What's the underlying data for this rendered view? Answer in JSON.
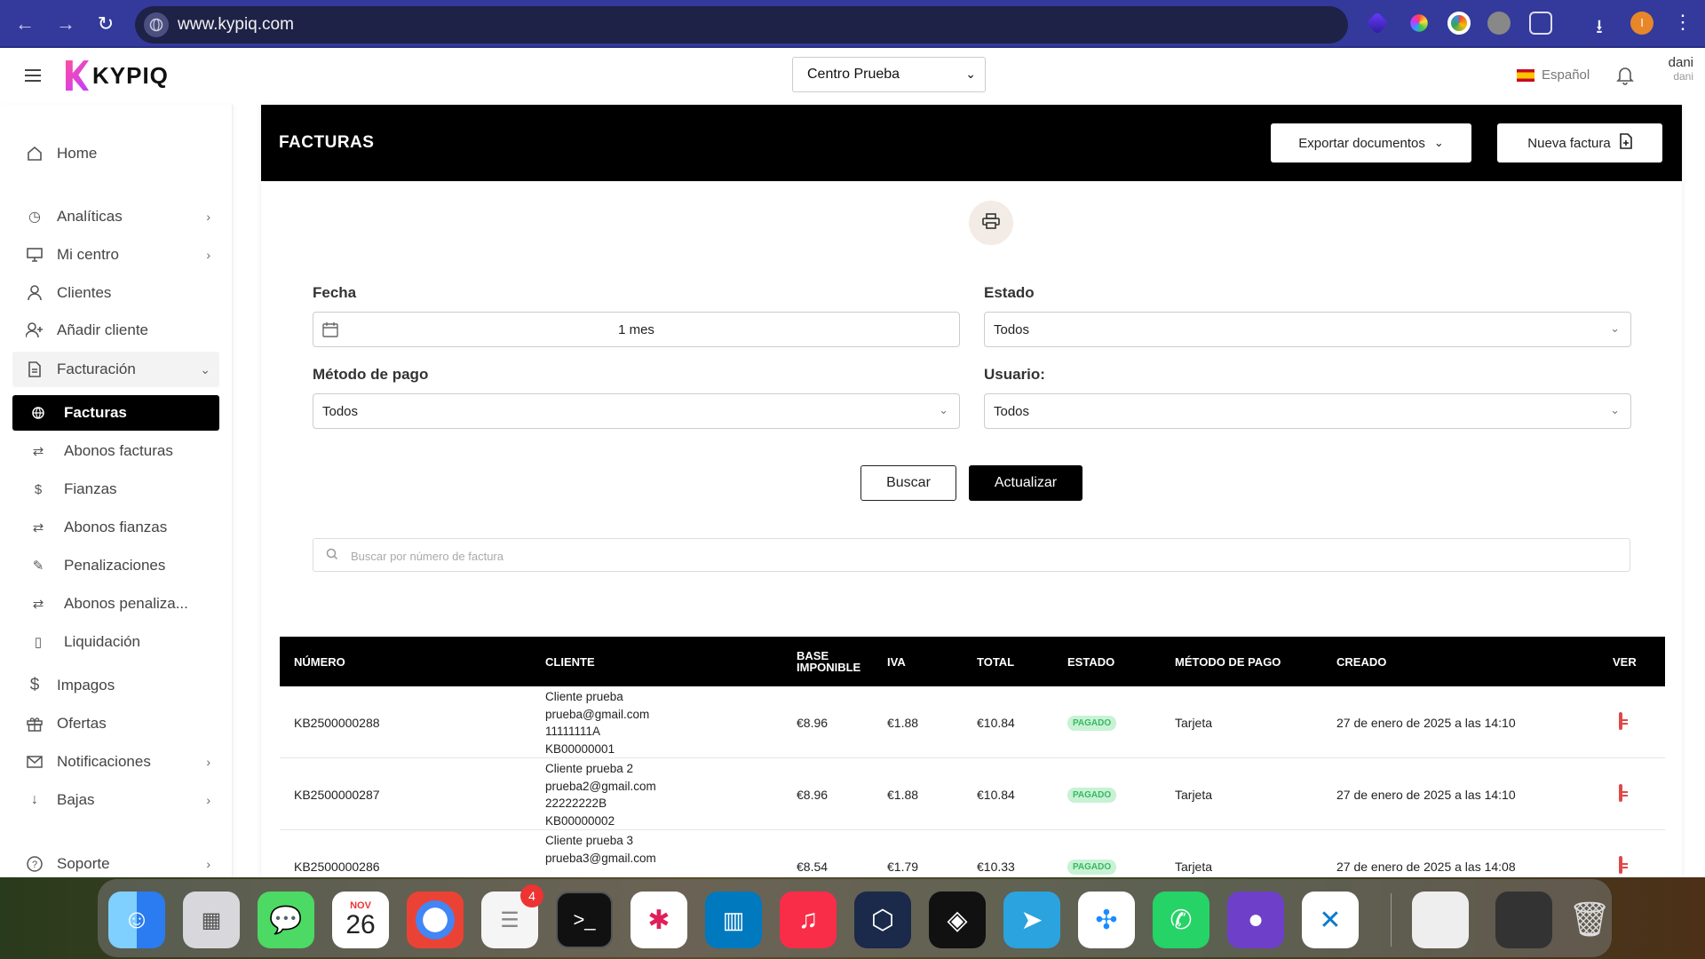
{
  "browser": {
    "url": "www.kypiq.com",
    "nav": {
      "back": "←",
      "forward": "→",
      "reload": "↻"
    },
    "profile_initial": "I"
  },
  "header": {
    "logo_text": "KYPIQ",
    "center_select": "Centro Prueba",
    "language": "Español",
    "user_name": "dani",
    "user_sub": "dani"
  },
  "sidebar": {
    "items": [
      {
        "label": "Home",
        "icon": "home-icon"
      },
      {
        "label": "Analíticas",
        "icon": "clock-icon"
      },
      {
        "label": "Mi centro",
        "icon": "monitor-icon"
      },
      {
        "label": "Clientes",
        "icon": "user-icon"
      },
      {
        "label": "Añadir cliente",
        "icon": "user-plus-icon"
      },
      {
        "label": "Facturación",
        "icon": "document-icon"
      },
      {
        "label": "Facturas",
        "icon": "globe-icon"
      },
      {
        "label": "Abonos facturas",
        "icon": "repeat-icon"
      },
      {
        "label": "Fianzas",
        "icon": "dollar-icon"
      },
      {
        "label": "Abonos fianzas",
        "icon": "repeat-icon"
      },
      {
        "label": "Penalizaciones",
        "icon": "pencil-icon"
      },
      {
        "label": "Abonos penaliza...",
        "icon": "repeat-icon"
      },
      {
        "label": "Liquidación",
        "icon": "book-icon"
      },
      {
        "label": "Impagos",
        "icon": "dollar-icon"
      },
      {
        "label": "Ofertas",
        "icon": "gift-icon"
      },
      {
        "label": "Notificaciones",
        "icon": "mail-icon"
      },
      {
        "label": "Bajas",
        "icon": "arrow-down-icon"
      },
      {
        "label": "Soporte",
        "icon": "help-icon"
      }
    ]
  },
  "page": {
    "title": "FACTURAS",
    "export_label": "Exportar documentos",
    "new_label": "Nueva factura"
  },
  "filters": {
    "fecha_label": "Fecha",
    "fecha_value": "1 mes",
    "estado_label": "Estado",
    "estado_value": "Todos",
    "metodo_label": "Método de pago",
    "metodo_value": "Todos",
    "usuario_label": "Usuario:",
    "usuario_value": "Todos",
    "buscar_label": "Buscar",
    "actualizar_label": "Actualizar",
    "search_placeholder": "Buscar por número de factura"
  },
  "table": {
    "headers": {
      "numero": "NÚMERO",
      "cliente": "CLIENTE",
      "base1": "BASE",
      "base2": "IMPONIBLE",
      "iva": "IVA",
      "total": "TOTAL",
      "estado": "ESTADO",
      "metodo": "MÉTODO DE PAGO",
      "creado": "CREADO",
      "ver": "VER"
    },
    "rows": [
      {
        "numero": "KB2500000288",
        "cliente_nombre": "Cliente prueba",
        "cliente_email": "prueba@gmail.com",
        "cliente_nif": "11111111A",
        "cliente_codigo": "KB00000001",
        "base": "€8.96",
        "iva": "€1.88",
        "total": "€10.84",
        "estado": "PAGADO",
        "metodo": "Tarjeta",
        "creado": "27 de enero de 2025 a las 14:10"
      },
      {
        "numero": "KB2500000287",
        "cliente_nombre": "Cliente prueba 2",
        "cliente_email": "prueba2@gmail.com",
        "cliente_nif": "22222222B",
        "cliente_codigo": "KB00000002",
        "base": "€8.96",
        "iva": "€1.88",
        "total": "€10.84",
        "estado": "PAGADO",
        "metodo": "Tarjeta",
        "creado": "27 de enero de 2025 a las 14:10"
      },
      {
        "numero": "KB2500000286",
        "cliente_nombre": "Cliente prueba 3",
        "cliente_email": "prueba3@gmail.com",
        "cliente_nif": "",
        "cliente_codigo": "",
        "base": "€8.54",
        "iva": "€1.79",
        "total": "€10.33",
        "estado": "PAGADO",
        "metodo": "Tarjeta",
        "creado": "27 de enero de 2025 a las 14:08"
      }
    ]
  },
  "dock": {
    "calendar_month": "NOV",
    "calendar_day": "26",
    "reminders_badge": "4"
  },
  "colors": {
    "chrome": "#333a9c",
    "accent": "#000000",
    "badge_bg": "#c8f2d4",
    "badge_fg": "#38b864",
    "pdf": "#e04848"
  }
}
